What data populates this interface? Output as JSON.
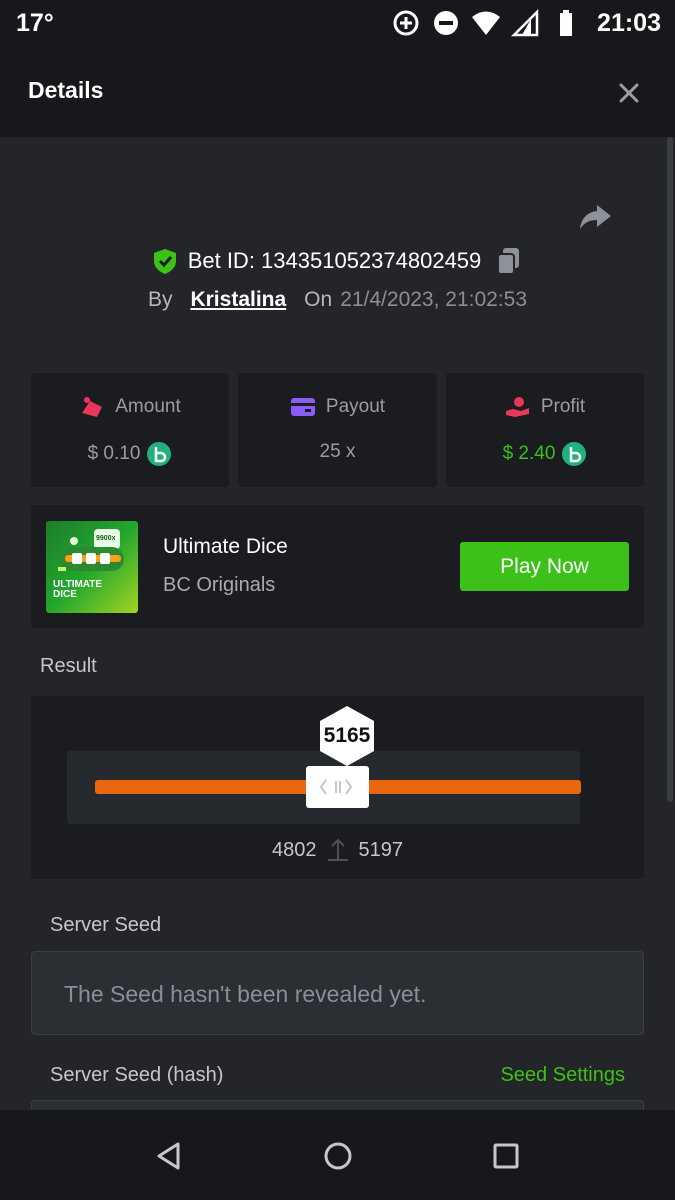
{
  "status_bar": {
    "temperature": "17°",
    "time": "21:03"
  },
  "header": {
    "title": "Details"
  },
  "bet": {
    "bet_id_label": "Bet ID: 134351052374802459",
    "by_label": "By",
    "username": "Kristalina",
    "on_label": "On",
    "date": "21/4/2023, 21:02:53"
  },
  "stats": {
    "amount": {
      "label": "Amount",
      "value": "$ 0.10"
    },
    "payout": {
      "label": "Payout",
      "value": "25 x"
    },
    "profit": {
      "label": "Profit",
      "value": "$ 2.40"
    }
  },
  "game": {
    "name": "Ultimate Dice",
    "provider": "BC Originals",
    "play_label": "Play Now",
    "thumb_text_1": "ULTIMATE",
    "thumb_text_2": "DICE",
    "thumb_badge": "9900x"
  },
  "result": {
    "label": "Result",
    "value": "5165",
    "range_low": "4802",
    "range_high": "5197"
  },
  "server_seed": {
    "label": "Server Seed",
    "placeholder": "The Seed hasn't been revealed yet."
  },
  "server_seed_hash": {
    "label": "Server Seed (hash)",
    "settings_label": "Seed Settings"
  },
  "colors": {
    "accent_green": "#3bc117",
    "bar_orange": "#ea6712",
    "background": "#232529",
    "card": "#1a1c1f"
  }
}
